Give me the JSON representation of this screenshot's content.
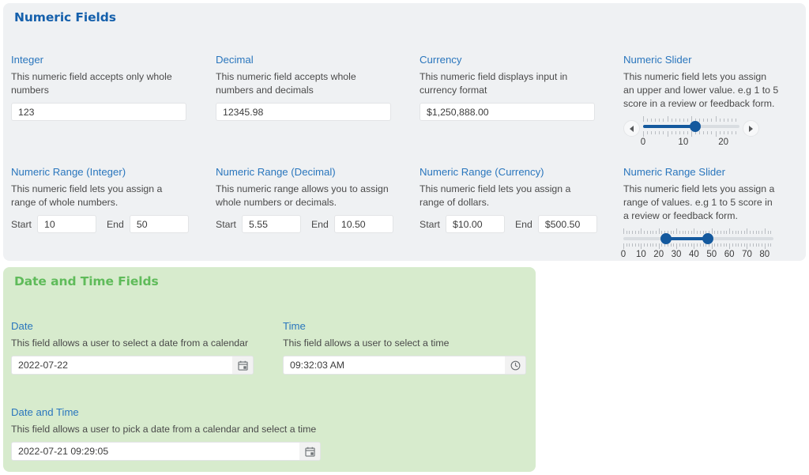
{
  "sections": {
    "numeric": {
      "title": "Numeric Fields",
      "color": "#1560ac",
      "fields": {
        "integer": {
          "label": "Integer",
          "desc": "This numeric field accepts only whole numbers",
          "value": "123"
        },
        "decimal": {
          "label": "Decimal",
          "desc": "This numeric field accepts whole numbers and decimals",
          "value": "12345.98"
        },
        "currency": {
          "label": "Currency",
          "desc": "This numeric field displays input in currency format",
          "value": "$1,250,888.00"
        },
        "numeric_slider": {
          "label": "Numeric Slider",
          "desc": "This numeric field lets you assign an upper and lower value. e.g 1 to 5 score in a review or feedback form.",
          "value": 13,
          "min": 0,
          "max": 24,
          "tick_labels": [
            "0",
            "10",
            "20"
          ],
          "decrement_icon": "left-arrow-icon",
          "increment_icon": "right-arrow-icon"
        },
        "range_integer": {
          "label": "Numeric Range (Integer)",
          "desc": "This numeric field lets you assign a range of whole numbers.",
          "start_label": "Start",
          "start_value": "10",
          "end_label": "End",
          "end_value": "50"
        },
        "range_decimal": {
          "label": "Numeric Range (Decimal)",
          "desc": "This numeric range allows you to assign whole numbers or decimals.",
          "start_label": "Start",
          "start_value": "5.55",
          "end_label": "End",
          "end_value": "10.50"
        },
        "range_currency": {
          "label": "Numeric Range (Currency)",
          "desc": "This numeric field lets you assign a range of dollars.",
          "start_label": "Start",
          "start_value": "$10.00",
          "end_label": "End",
          "end_value": "$500.50"
        },
        "range_slider": {
          "label": "Numeric Range Slider",
          "desc": "This numeric field lets you assign a range of values. e.g 1 to 5 score in a review or feedback form.",
          "start_value": 24,
          "end_value": 48,
          "min": 0,
          "max": 85,
          "tick_labels": [
            "0",
            "10",
            "20",
            "30",
            "40",
            "50",
            "60",
            "70",
            "80"
          ]
        }
      }
    },
    "datetime": {
      "title": "Date and Time Fields",
      "color": "#5fbb5a",
      "fields": {
        "date": {
          "label": "Date",
          "desc": "This field allows a user to select a date from a calendar",
          "value": "2022-07-22",
          "icon": "calendar-icon"
        },
        "time": {
          "label": "Time",
          "desc": "This field allows a user to select a time",
          "value": "09:32:03 AM",
          "icon": "clock-icon"
        },
        "date_and_time": {
          "label": "Date and Time",
          "desc": "This field allows a user to pick a date from a calendar and select a time",
          "value": "2022-07-21 09:29:05",
          "icon": "calendar-icon"
        }
      }
    }
  }
}
